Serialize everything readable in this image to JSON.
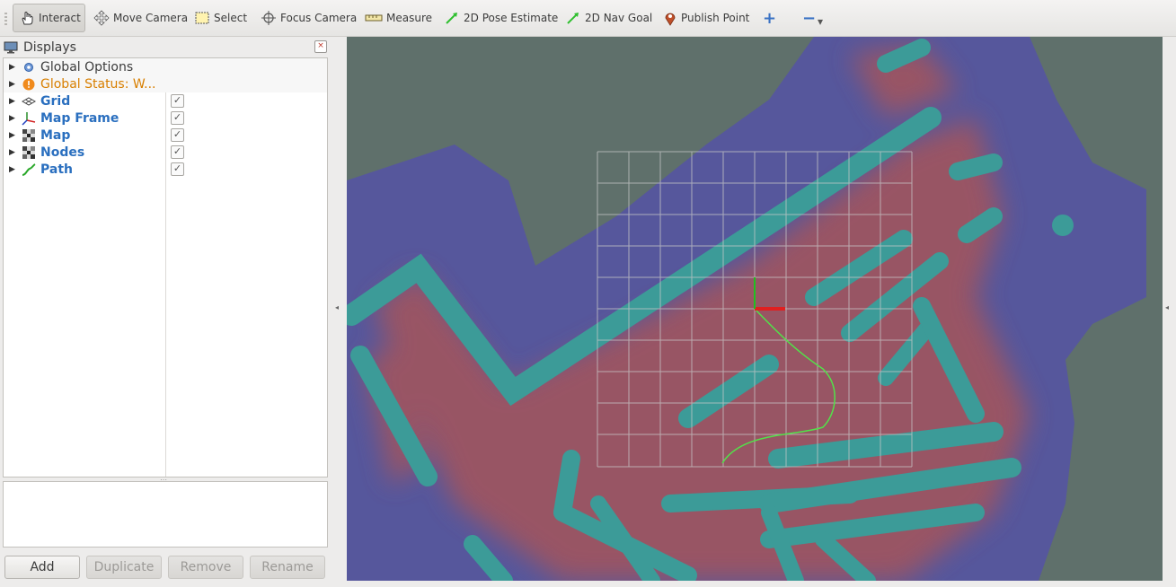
{
  "toolbar": {
    "tools": [
      {
        "label": "Interact",
        "icon": "hand-icon",
        "active": true
      },
      {
        "label": "Move Camera",
        "icon": "move-camera-icon"
      },
      {
        "label": "Select",
        "icon": "select-icon"
      },
      {
        "label": "Focus Camera",
        "icon": "focus-camera-icon"
      },
      {
        "label": "Measure",
        "icon": "ruler-icon"
      },
      {
        "label": "2D Pose Estimate",
        "icon": "pose-arrow-icon"
      },
      {
        "label": "2D Nav Goal",
        "icon": "nav-goal-arrow-icon"
      },
      {
        "label": "Publish Point",
        "icon": "map-pin-icon"
      }
    ],
    "add_glyph": "+",
    "remove_glyph": "−",
    "dropdown_glyph": "▾"
  },
  "displays": {
    "title": "Displays",
    "close_glyph": "×",
    "items": [
      {
        "label": "Global Options",
        "icon": "gear-icon",
        "style": "normal",
        "checked": null
      },
      {
        "label": "Global Status: W...",
        "icon": "warning-icon",
        "style": "warn",
        "checked": null
      },
      {
        "label": "Grid",
        "icon": "grid-icon",
        "style": "bold",
        "checked": true
      },
      {
        "label": "Map Frame",
        "icon": "axes-icon",
        "style": "bold",
        "checked": true
      },
      {
        "label": "Map",
        "icon": "map-icon",
        "style": "bold",
        "checked": true
      },
      {
        "label": "Nodes",
        "icon": "nodes-icon",
        "style": "bold",
        "checked": true
      },
      {
        "label": "Path",
        "icon": "path-icon",
        "style": "bold",
        "checked": true
      }
    ],
    "check_glyph": "✓",
    "expand_glyph": "▶"
  },
  "buttons": {
    "add": "Add",
    "duplicate": "Duplicate",
    "remove": "Remove",
    "rename": "Rename"
  },
  "colors": {
    "unknown_space": "#5f706b",
    "cost_high": "#a0555f",
    "cost_low": "#56579c",
    "obstacle": "#3c9b98",
    "path": "#52e24a",
    "axis_x": "#e02020",
    "axis_y": "#20c020"
  },
  "collapse_glyph_left": "◂",
  "collapse_glyph_right": "◂"
}
